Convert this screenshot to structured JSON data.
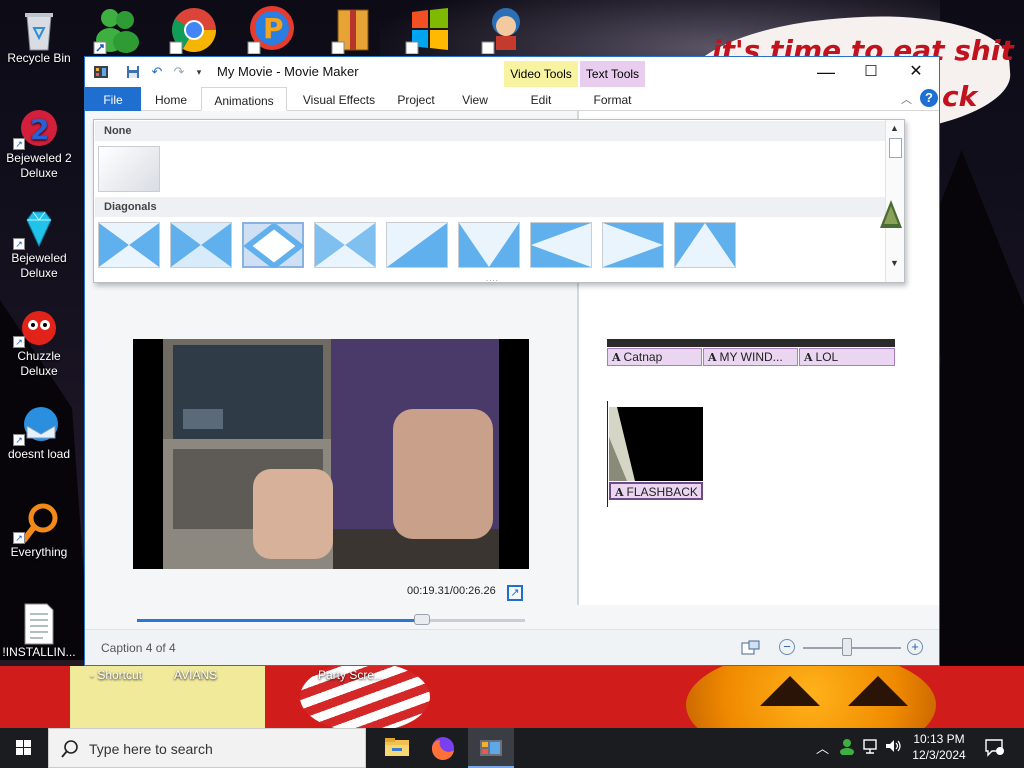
{
  "wallpaper": {
    "line1": "it's time to eat shit",
    "line2": "ck"
  },
  "desktop_icons": [
    {
      "label": "Recycle Bin",
      "icon": "recycle-bin-icon"
    },
    {
      "label": "Bejeweled 2 Deluxe",
      "icon": "bejeweled2-icon"
    },
    {
      "label": "Bejeweled Deluxe",
      "icon": "bejeweled-icon"
    },
    {
      "label": "Chuzzle Deluxe",
      "icon": "chuzzle-icon"
    },
    {
      "label": "doesnt load",
      "icon": "thunderbird-icon"
    },
    {
      "label": "Everything",
      "icon": "everything-icon"
    },
    {
      "label": "!INSTALLIN...",
      "icon": "text-file-icon"
    }
  ],
  "wallpaper_labels": [
    "- Shortcut",
    "AVIANS",
    "Party Scre..."
  ],
  "window": {
    "title": "My Movie - Movie Maker",
    "context_tabs": {
      "video_tools": "Video Tools",
      "text_tools": "Text Tools"
    },
    "tabs": [
      "File",
      "Home",
      "Animations",
      "Visual Effects",
      "Project",
      "View",
      "Edit",
      "Format"
    ],
    "active_tab": "Animations",
    "controls": {
      "minimize": "—",
      "maximize": "☐",
      "close": "✕",
      "help": "?"
    }
  },
  "gallery": {
    "sections": [
      "None",
      "Diagonals"
    ],
    "selected_index": 2
  },
  "preview": {
    "time": "00:19.31/00:26.26",
    "progress": 0.735,
    "buttons": {
      "prev_frame": "◀▌",
      "play": "▶",
      "next_frame": "▐▶"
    }
  },
  "timeline": {
    "captions": [
      "Catnap",
      "MY WIND...",
      "LOL",
      "FLASHBACK"
    ],
    "caption_marker": "A"
  },
  "status": {
    "text": "Caption 4 of 4",
    "zoom": 0.45
  },
  "taskbar": {
    "search_placeholder": "Type here to search",
    "time": "10:13 PM",
    "date": "12/3/2024"
  },
  "colors": {
    "ribbon_blue": "#1e6fcf",
    "video_tools": "#f7f3a1",
    "text_tools": "#e8cdef",
    "caption": "#ebd6f1"
  }
}
